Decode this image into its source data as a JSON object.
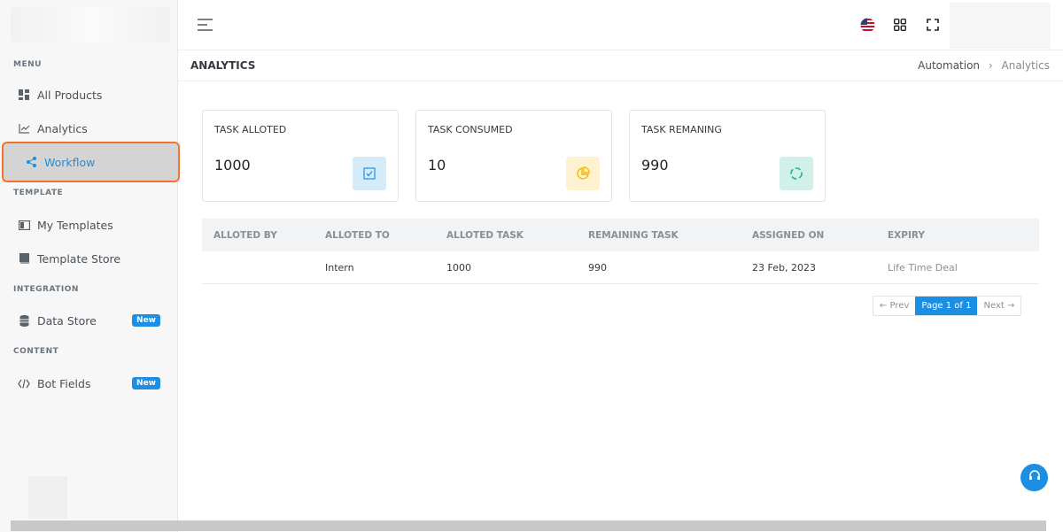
{
  "sidebar": {
    "sections": {
      "menu": "MENU",
      "template": "TEMPLATE",
      "integration": "INTEGRATION",
      "content": "CONTENT"
    },
    "items": {
      "all_products": "All Products",
      "analytics": "Analytics",
      "workflow": "Workflow",
      "my_templates": "My Templates",
      "template_store": "Template Store",
      "data_store": "Data Store",
      "bot_fields": "Bot Fields"
    },
    "badge_new": "New"
  },
  "header": {
    "title": "ANALYTICS",
    "breadcrumb_parent": "Automation",
    "breadcrumb_sep": "›",
    "breadcrumb_current": "Analytics"
  },
  "cards": [
    {
      "title": "TASK ALLOTED",
      "value": "1000",
      "icon": "checkbox-icon",
      "color": "#d6ebf8"
    },
    {
      "title": "TASK CONSUMED",
      "value": "10",
      "icon": "pie-chart-icon",
      "color": "#fdf1cf"
    },
    {
      "title": "TASK REMANING",
      "value": "990",
      "icon": "loader-icon",
      "color": "#d1f0e9"
    }
  ],
  "table": {
    "headers": [
      "ALLOTED BY",
      "ALLOTED TO",
      "ALLOTED TASK",
      "REMAINING TASK",
      "ASSIGNED ON",
      "EXPIRY"
    ],
    "rows": [
      [
        "",
        "Intern",
        "1000",
        "990",
        "23 Feb, 2023",
        "Life Time Deal"
      ]
    ]
  },
  "pagination": {
    "prev": "← Prev",
    "page": "Page 1 of 1",
    "next": "Next →"
  },
  "colors": {
    "accent": "#1a8fe3",
    "highlight_border": "#f5722e"
  }
}
